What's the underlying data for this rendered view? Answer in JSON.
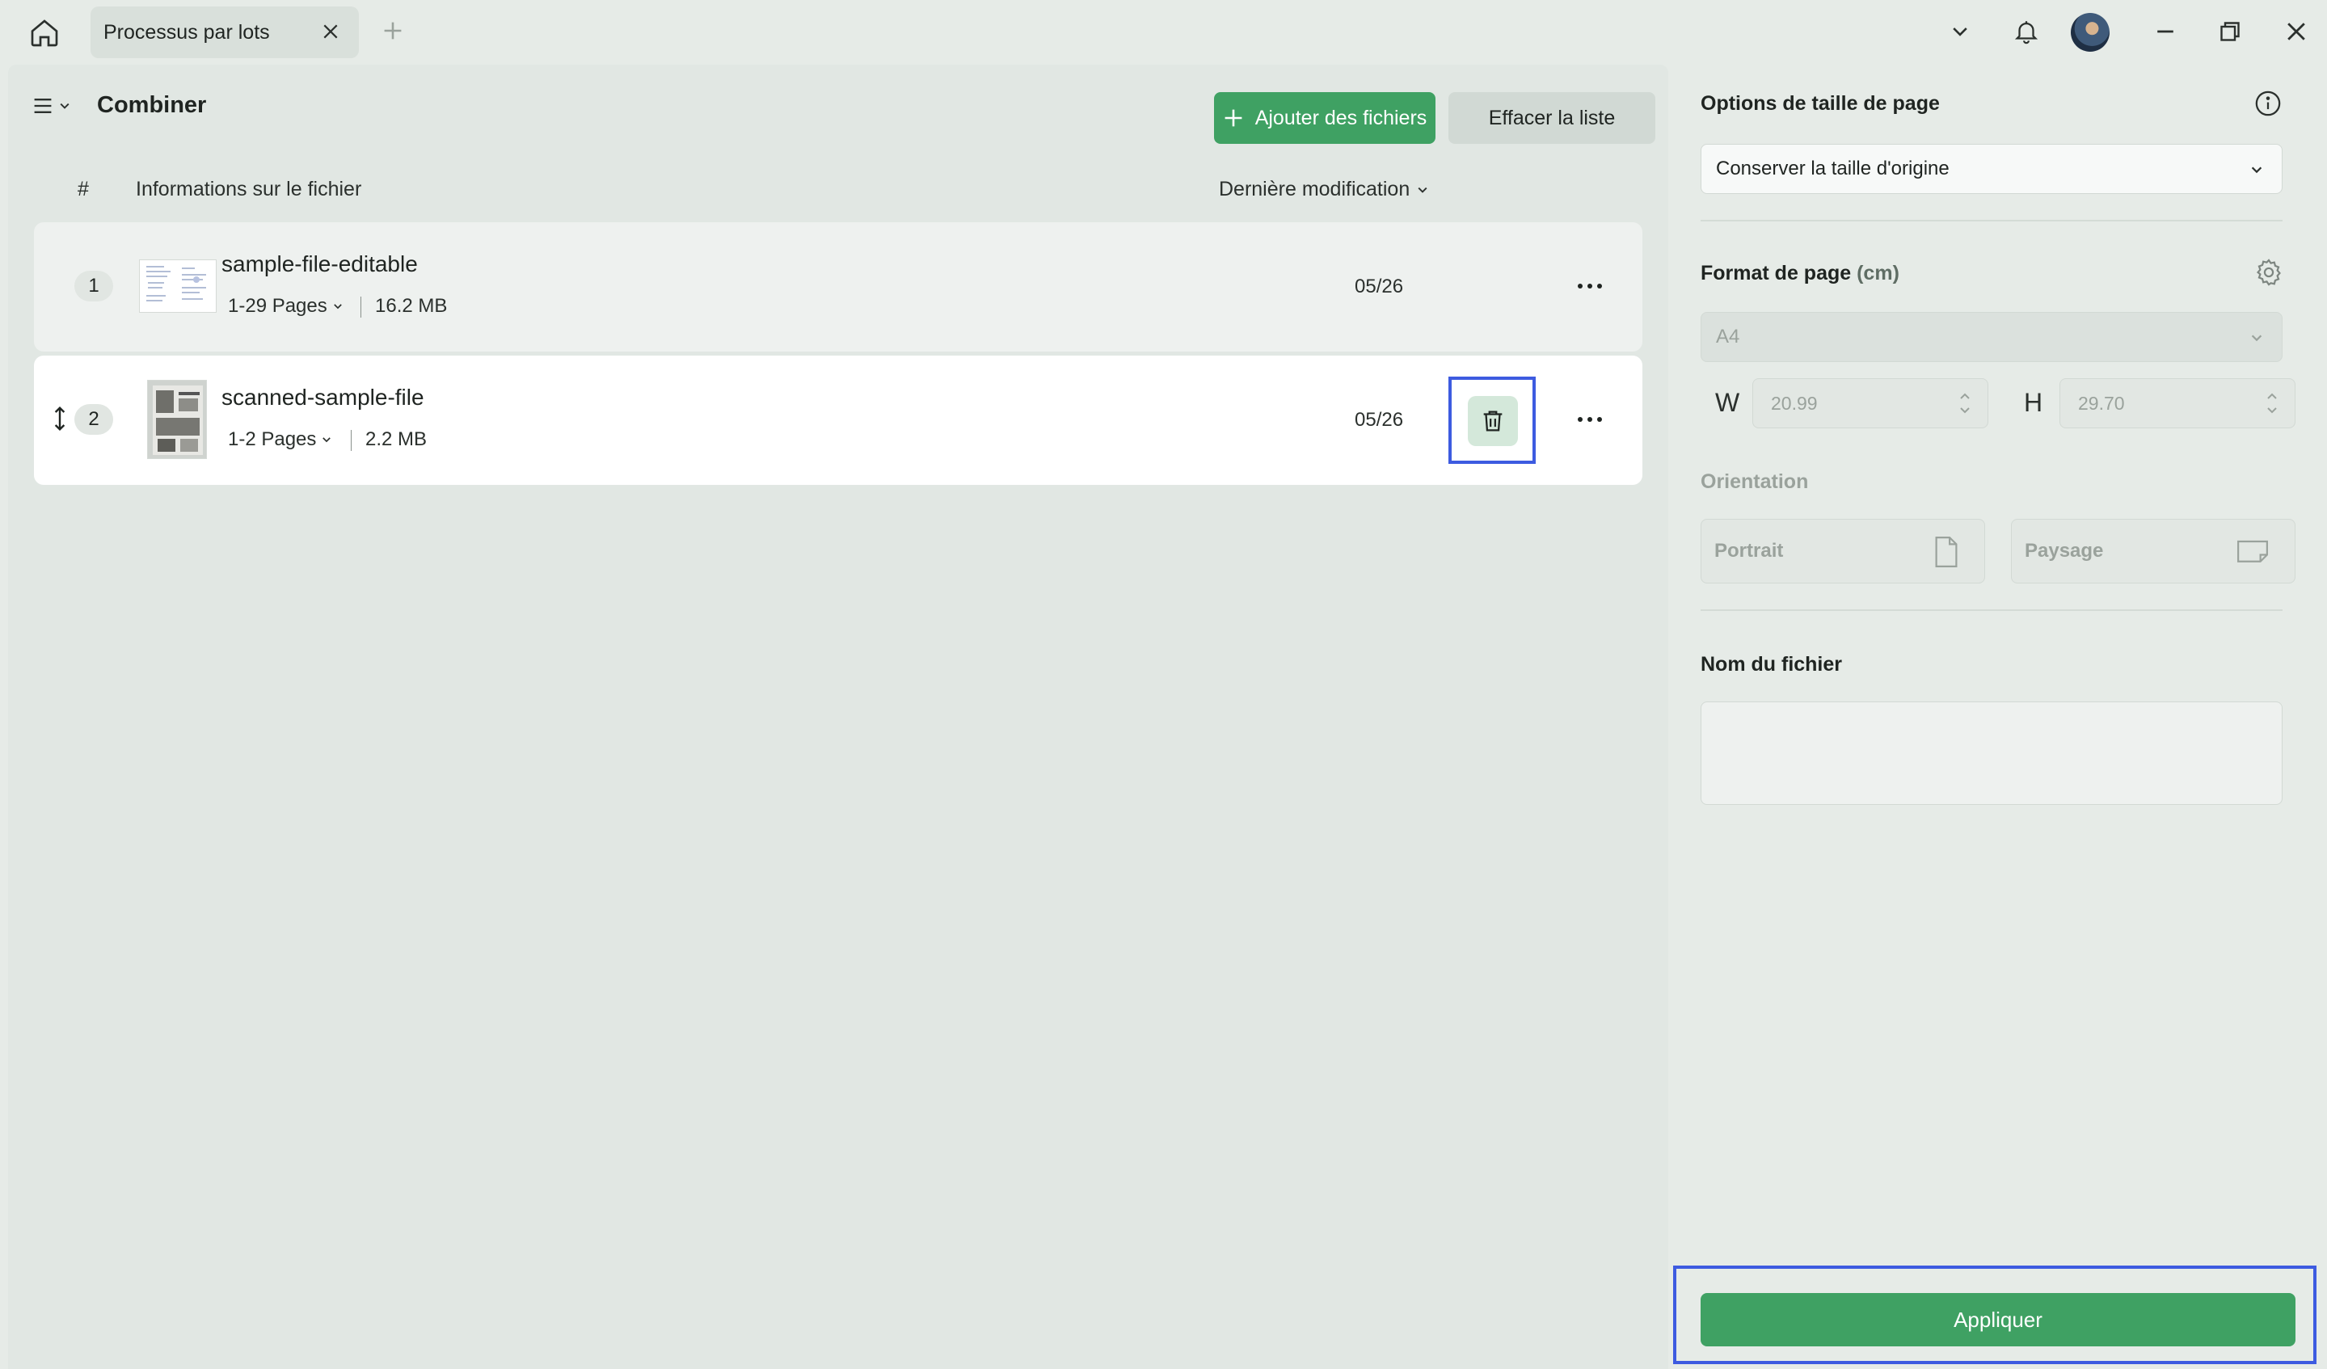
{
  "tab": {
    "title": "Processus par lots"
  },
  "header": {
    "title": "Combiner",
    "add_label": "Ajouter des fichiers",
    "clear_label": "Effacer la liste"
  },
  "columns": {
    "index": "#",
    "info": "Informations sur le fichier",
    "modified": "Dernière modification"
  },
  "files": [
    {
      "index": "1",
      "name": "sample-file-editable",
      "pages": "1-29 Pages",
      "size": "16.2 MB",
      "date": "05/26"
    },
    {
      "index": "2",
      "name": "scanned-sample-file",
      "pages": "1-2 Pages",
      "size": "2.2 MB",
      "date": "05/26"
    }
  ],
  "side": {
    "page_size_options_label": "Options de taille de page",
    "page_size_value": "Conserver la taille d'origine",
    "page_format_label": "Format de page",
    "page_format_unit": "(cm)",
    "format_value": "A4",
    "width_label": "W",
    "width_value": "20.99",
    "height_label": "H",
    "height_value": "29.70",
    "orientation_label": "Orientation",
    "portrait_label": "Portrait",
    "landscape_label": "Paysage",
    "filename_label": "Nom du fichier",
    "filename_value": "",
    "apply_label": "Appliquer"
  },
  "colors": {
    "accent": "#3fa163",
    "highlight": "#3d5be0"
  }
}
